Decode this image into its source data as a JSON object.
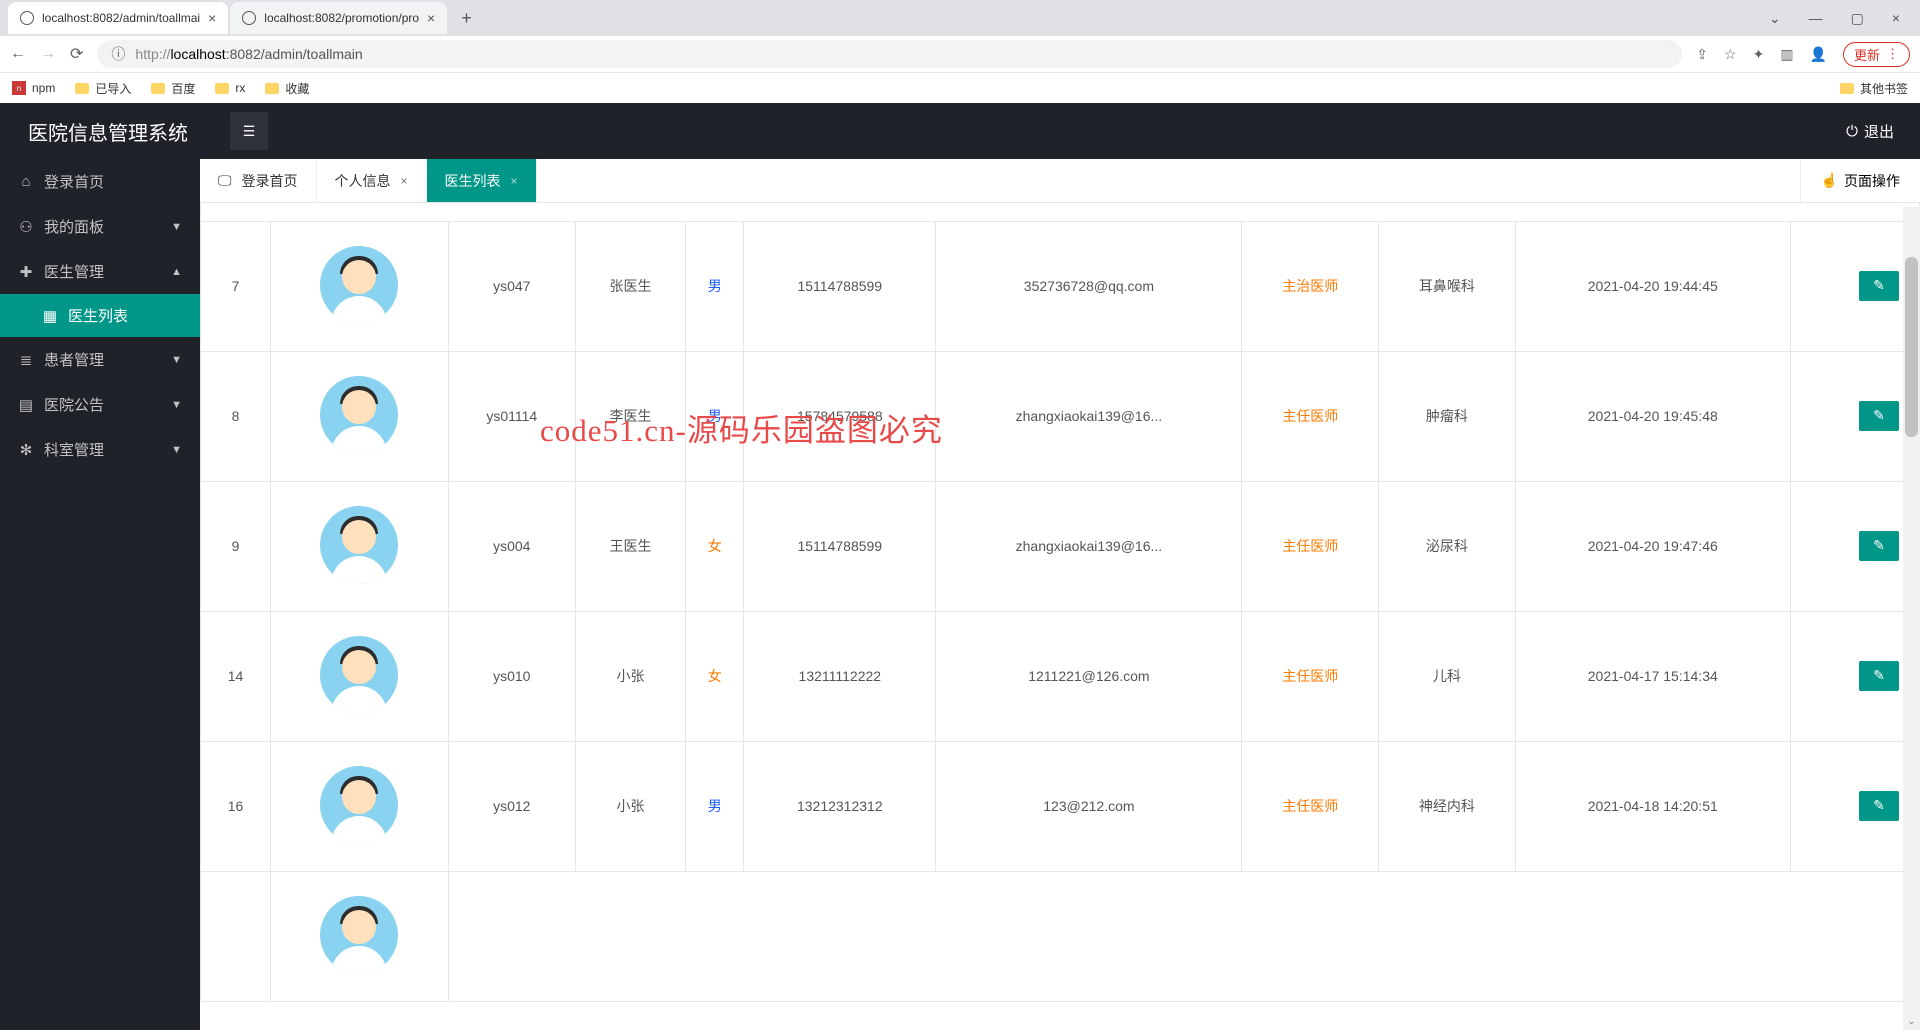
{
  "browser": {
    "tabs": [
      {
        "title": "localhost:8082/admin/toallmai"
      },
      {
        "title": "localhost:8082/promotion/pro"
      }
    ],
    "url": "http://localhost:8082/admin/toallmain",
    "url_prefix": "http://",
    "url_host": "localhost",
    "url_rest": ":8082/admin/toallmain",
    "update_label": "更新",
    "bookmarks": [
      "npm",
      "已导入",
      "百度",
      "rx",
      "收藏"
    ],
    "other_bookmarks": "其他书签"
  },
  "app": {
    "title": "医院信息管理系统",
    "logout": "退出"
  },
  "sidebar": {
    "items": [
      {
        "label": "登录首页",
        "icon": "⌂"
      },
      {
        "label": "我的面板",
        "icon": "⚇"
      },
      {
        "label": "医生管理",
        "icon": "✚"
      },
      {
        "label": "患者管理",
        "icon": "≣"
      },
      {
        "label": "医院公告",
        "icon": "▤"
      },
      {
        "label": "科室管理",
        "icon": "✻"
      }
    ],
    "submenu_doctor_list": "医生列表"
  },
  "tabs": {
    "items": [
      "登录首页",
      "个人信息",
      "医生列表"
    ],
    "page_action": "页面操作"
  },
  "table": {
    "rows": [
      {
        "id": "7",
        "username": "ys047",
        "name": "张医生",
        "gender": "男",
        "phone": "15114788599",
        "email": "352736728@qq.com",
        "title": "主治医师",
        "dept": "耳鼻喉科",
        "time": "2021-04-20 19:44:45"
      },
      {
        "id": "8",
        "username": "ys01114",
        "name": "李医生",
        "gender": "男",
        "phone": "15784579588",
        "email": "zhangxiaokai139@16...",
        "title": "主任医师",
        "dept": "肿瘤科",
        "time": "2021-04-20 19:45:48"
      },
      {
        "id": "9",
        "username": "ys004",
        "name": "王医生",
        "gender": "女",
        "phone": "15114788599",
        "email": "zhangxiaokai139@16...",
        "title": "主任医师",
        "dept": "泌尿科",
        "time": "2021-04-20 19:47:46"
      },
      {
        "id": "14",
        "username": "ys010",
        "name": "小张",
        "gender": "女",
        "phone": "13211112222",
        "email": "1211221@126.com",
        "title": "主任医师",
        "dept": "儿科",
        "time": "2021-04-17 15:14:34"
      },
      {
        "id": "16",
        "username": "ys012",
        "name": "小张",
        "gender": "男",
        "phone": "13212312312",
        "email": "123@212.com",
        "title": "主任医师",
        "dept": "神经内科",
        "time": "2021-04-18 14:20:51"
      }
    ]
  },
  "watermark": "code51.cn-源码乐园盗图必究"
}
